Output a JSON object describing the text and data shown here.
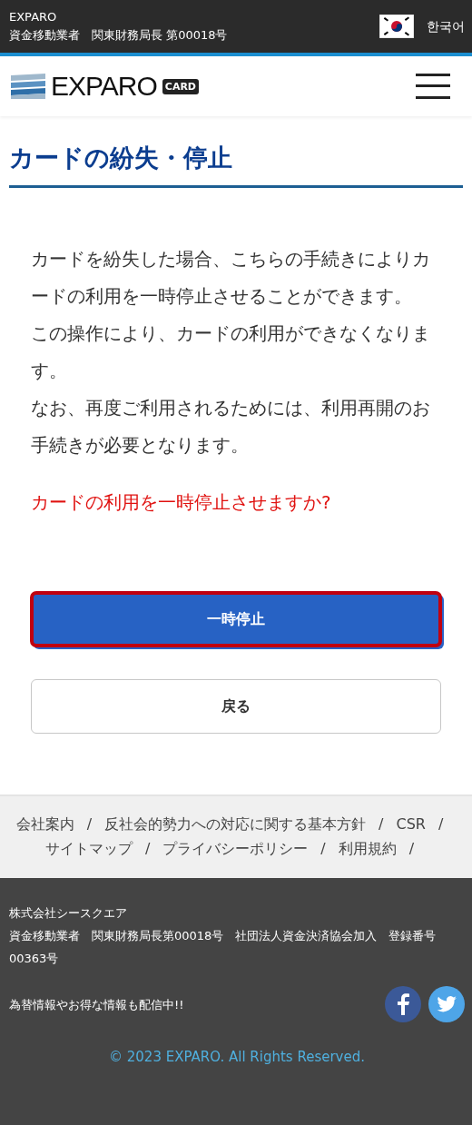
{
  "top_bar": {
    "brand": "EXPARO",
    "registration": "資金移動業者　関東財務局長 第00018号",
    "language": "한국어"
  },
  "header": {
    "logo_text": "EXPARO",
    "logo_badge": "CARD"
  },
  "page_title": "カードの紛失・停止",
  "paragraphs": [
    "カードを紛失した場合、こちらの手続きによりカードの利用を一時停止させることができます。",
    "この操作により、カードの利用ができなくなります。",
    "なお、再度ご利用されるためには、利用再開のお手続きが必要となります。"
  ],
  "question": "カードの利用を一時停止させますか?",
  "buttons": [
    {
      "label": "一時停止",
      "kind": "primary",
      "focused": true
    },
    {
      "label": "戻る",
      "kind": "secondary",
      "focused": false
    }
  ],
  "footer_links": [
    {
      "label": "会社案内",
      "separator": "/"
    },
    {
      "label": "反社会的勢力への対応に関する基本方針",
      "separator": "/"
    },
    {
      "label": "CSR",
      "separator": "/"
    },
    {
      "label": "サイトマップ",
      "separator": "/"
    },
    {
      "label": "プライバシーポリシー",
      "separator": "/"
    },
    {
      "label": "利用規約",
      "separator": "/"
    }
  ],
  "footer": {
    "company": "株式会社シースクエア",
    "registration": "資金移動業者　関東財務局長第00018号　社団法人資金決済協会加入　登録番号00363号",
    "social_note": "為替情報やお得な情報も配信中!!",
    "copyright": "© 2023 EXPARO. All Rights Reserved."
  }
}
